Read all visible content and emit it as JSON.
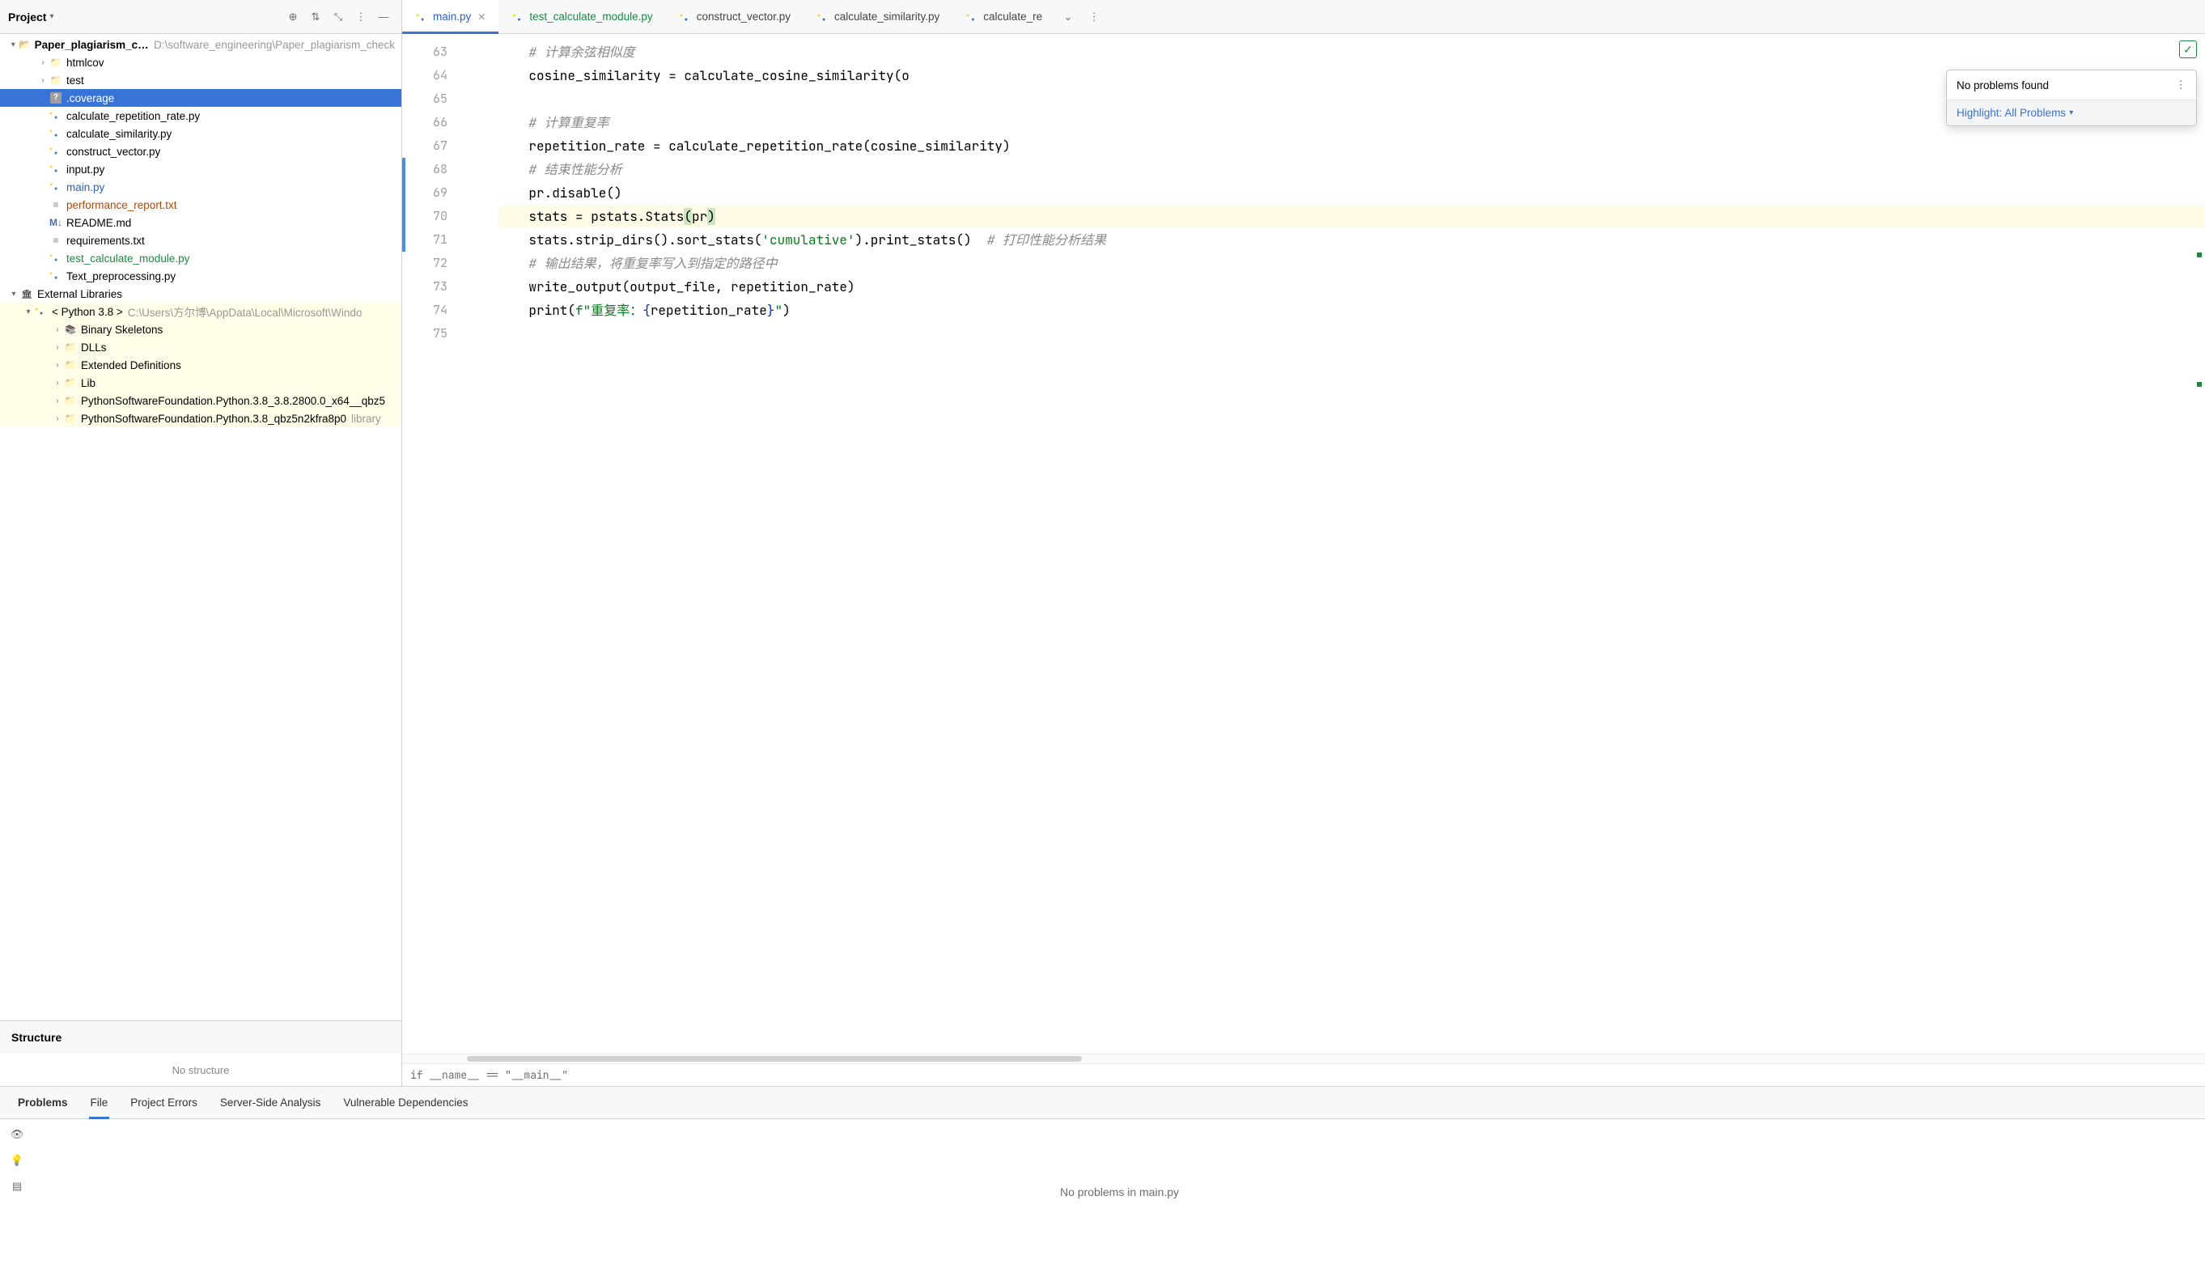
{
  "sidebar": {
    "title": "Project",
    "root": {
      "name": "Paper_plagiarism_check",
      "path": "D:\\software_engineering\\Paper_plagiarism_check"
    },
    "items": [
      {
        "d": 1,
        "arrow": ">",
        "icon": "folder",
        "label": "htmlcov"
      },
      {
        "d": 1,
        "arrow": ">",
        "icon": "folder",
        "label": "test"
      },
      {
        "d": 1,
        "arrow": "",
        "icon": "q",
        "label": ".coverage",
        "selected": true
      },
      {
        "d": 1,
        "arrow": "",
        "icon": "py",
        "label": "calculate_repetition_rate.py"
      },
      {
        "d": 1,
        "arrow": "",
        "icon": "py",
        "label": "calculate_similarity.py"
      },
      {
        "d": 1,
        "arrow": "",
        "icon": "py",
        "label": "construct_vector.py"
      },
      {
        "d": 1,
        "arrow": "",
        "icon": "py",
        "label": "input.py"
      },
      {
        "d": 1,
        "arrow": "",
        "icon": "py",
        "label": "main.py",
        "color": "#2b5fc1"
      },
      {
        "d": 1,
        "arrow": "",
        "icon": "txt",
        "label": "performance_report.txt",
        "color": "#b34700"
      },
      {
        "d": 1,
        "arrow": "",
        "icon": "md",
        "label": "README.md"
      },
      {
        "d": 1,
        "arrow": "",
        "icon": "txt",
        "label": "requirements.txt"
      },
      {
        "d": 1,
        "arrow": "",
        "icon": "py",
        "label": "test_calculate_module.py",
        "color": "#1a8a3f"
      },
      {
        "d": 1,
        "arrow": "",
        "icon": "py",
        "label": "Text_preprocessing.py"
      }
    ],
    "ext": {
      "label": "External Libraries",
      "python": {
        "label": "< Python 3.8 >",
        "path": "C:\\Users\\方尔博\\AppData\\Local\\Microsoft\\Windo"
      },
      "children": [
        {
          "arrow": ">",
          "icon": "book",
          "label": "Binary Skeletons"
        },
        {
          "arrow": ">",
          "icon": "folder",
          "label": "DLLs"
        },
        {
          "arrow": ">",
          "icon": "folder",
          "label": "Extended Definitions"
        },
        {
          "arrow": ">",
          "icon": "folder",
          "label": "Lib"
        },
        {
          "arrow": ">",
          "icon": "folder",
          "label": "PythonSoftwareFoundation.Python.3.8_3.8.2800.0_x64__qbz5"
        },
        {
          "arrow": ">",
          "icon": "folder",
          "label": "PythonSoftwareFoundation.Python.3.8_qbz5n2kfra8p0",
          "hint": "library"
        }
      ]
    }
  },
  "structure": {
    "title": "Structure",
    "body": "No structure"
  },
  "tabs": [
    {
      "label": "main.py",
      "active": true,
      "style": "blue-text",
      "close": true
    },
    {
      "label": "test_calculate_module.py",
      "style": "green-text"
    },
    {
      "label": "construct_vector.py"
    },
    {
      "label": "calculate_similarity.py"
    },
    {
      "label": "calculate_re"
    }
  ],
  "editor": {
    "lines": [
      {
        "n": 63,
        "tokens": [
          {
            "t": "    # 计算余弦相似度",
            "c": "comment"
          }
        ]
      },
      {
        "n": 64,
        "tokens": [
          {
            "t": "    cosine_similarity = calculate_cosine_similarity(o"
          }
        ]
      },
      {
        "n": 65,
        "tokens": [
          {
            "t": ""
          }
        ]
      },
      {
        "n": 66,
        "tokens": [
          {
            "t": "    # 计算重复率",
            "c": "comment"
          }
        ]
      },
      {
        "n": 67,
        "tokens": [
          {
            "t": "    repetition_rate = calculate_repetition_rate(cosine_similarity)"
          }
        ]
      },
      {
        "n": 68,
        "tokens": [
          {
            "t": "    # 结束性能分析",
            "c": "comment"
          }
        ],
        "strip": true
      },
      {
        "n": 69,
        "tokens": [
          {
            "t": "    pr.disable()"
          }
        ],
        "strip": true
      },
      {
        "n": 70,
        "hl": true,
        "strip": true,
        "tokens": [
          {
            "t": "    stats = pstats.Stats"
          },
          {
            "t": "(",
            "c": "paren-hl"
          },
          {
            "t": "pr"
          },
          {
            "t": ")",
            "c": "paren-hl"
          }
        ]
      },
      {
        "n": 71,
        "strip": true,
        "tokens": [
          {
            "t": "    stats.strip_dirs().sort_stats("
          },
          {
            "t": "'cumulative'",
            "c": "string"
          },
          {
            "t": ").print_stats()  "
          },
          {
            "t": "# 打印性能分析结果",
            "c": "comment"
          }
        ]
      },
      {
        "n": 72,
        "tokens": [
          {
            "t": "    # 输出结果，将重复率写入到指定的路径中",
            "c": "comment"
          }
        ]
      },
      {
        "n": 73,
        "tokens": [
          {
            "t": "    write_output(output_file, repetition_rate)"
          }
        ]
      },
      {
        "n": 74,
        "tokens": [
          {
            "t": "    print("
          },
          {
            "t": "f\"重复率：",
            "c": "string"
          },
          {
            "t": "{",
            "c": "fstring-brace"
          },
          {
            "t": "repetition_rate"
          },
          {
            "t": "}",
            "c": "fstring-brace"
          },
          {
            "t": "\"",
            "c": "string"
          },
          {
            "t": ")"
          }
        ]
      },
      {
        "n": 75,
        "tokens": [
          {
            "t": ""
          }
        ]
      }
    ],
    "breadcrumb": "if __name__ == \"__main__\""
  },
  "problems_popup": {
    "title": "No problems found",
    "highlight_label": "Highlight: All Problems"
  },
  "bottom": {
    "tabs": [
      "Problems",
      "File",
      "Project Errors",
      "Server-Side Analysis",
      "Vulnerable Dependencies"
    ],
    "active": 0,
    "underline": 1,
    "message": "No problems in main.py"
  }
}
